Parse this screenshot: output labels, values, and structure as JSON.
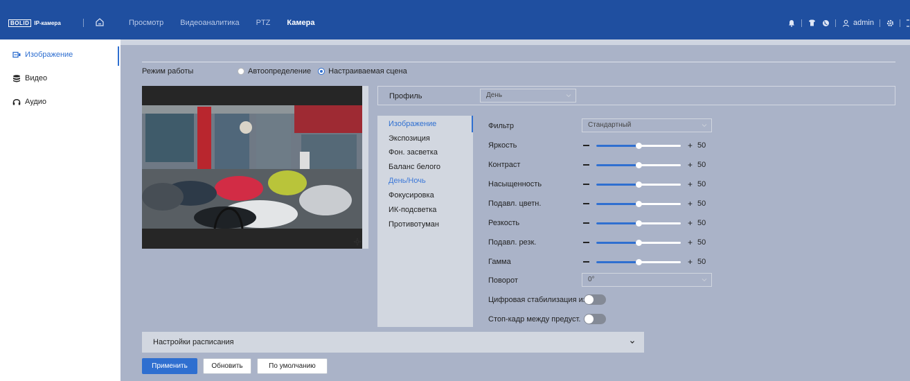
{
  "header": {
    "logo_box": "BOLID",
    "logo_text": "IP-камера",
    "nav": [
      "Просмотр",
      "Видеоаналитика",
      "PTZ",
      "Камера"
    ],
    "active_nav": "Камера",
    "user": "admin"
  },
  "sidebar": {
    "items": [
      {
        "label": "Изображение",
        "icon": "image-icon",
        "active": true
      },
      {
        "label": "Видео",
        "icon": "video-stack-icon",
        "active": false
      },
      {
        "label": "Аудио",
        "icon": "headphones-icon",
        "active": false
      }
    ]
  },
  "mode": {
    "label": "Режим работы",
    "options": [
      "Автоопределение",
      "Настраиваемая сцена"
    ],
    "selected": "Настраиваемая сцена"
  },
  "profile": {
    "label": "Профиль",
    "value": "День"
  },
  "submenu": {
    "items": [
      "Изображение",
      "Экспозиция",
      "Фон. засветка",
      "Баланс белого",
      "День/Ночь",
      "Фокусировка",
      "ИК-подсветка",
      "Противотуман"
    ],
    "active": "Изображение",
    "highlighted": "День/Ночь"
  },
  "settings": {
    "filter": {
      "label": "Фильтр",
      "value": "Стандартный"
    },
    "sliders": [
      {
        "label": "Яркость",
        "value": 50
      },
      {
        "label": "Контраст",
        "value": 50
      },
      {
        "label": "Насыщенность",
        "value": 50
      },
      {
        "label": "Подавл. цветн.",
        "value": 50
      },
      {
        "label": "Резкость",
        "value": 50
      },
      {
        "label": "Подавл. резк.",
        "value": 50
      },
      {
        "label": "Гамма",
        "value": 50
      }
    ],
    "plus_sign": "+",
    "rotation": {
      "label": "Поворот",
      "value": "0°"
    },
    "toggles": [
      {
        "label": "Цифровая стабилизация из...",
        "on": false
      },
      {
        "label": "Стоп-кадр между предуст.",
        "on": false
      }
    ]
  },
  "schedule": {
    "label": "Настройки расписания"
  },
  "buttons": {
    "apply": "Применить",
    "refresh": "Обновить",
    "default": "По умолчанию"
  },
  "colors": {
    "header_bg": "#1f4fa0",
    "accent": "#2f6fd0",
    "content_bg": "#aab3c8",
    "panel_bg": "#d2d7e0"
  }
}
